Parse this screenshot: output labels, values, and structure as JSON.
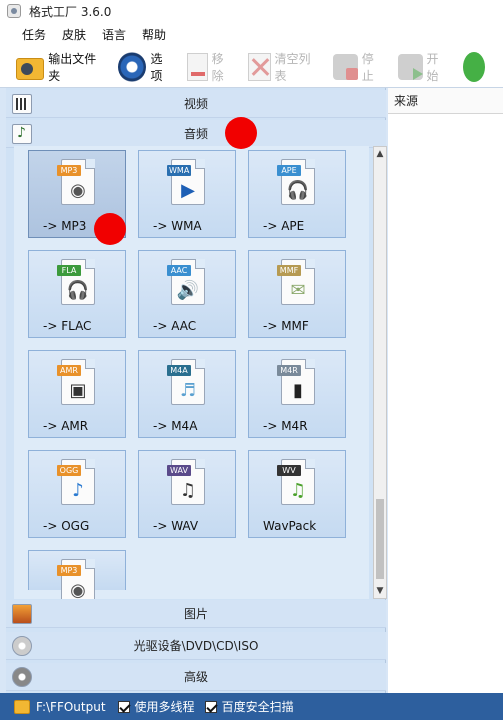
{
  "window": {
    "title": "格式工厂 3.6.0"
  },
  "menubar": {
    "items": [
      "任务",
      "皮肤",
      "语言",
      "帮助"
    ]
  },
  "toolbar": {
    "output_folder": "输出文件夹",
    "options": "选项",
    "remove": "移除",
    "clear_list": "清空列表",
    "stop": "停止",
    "start": "开始"
  },
  "categories": {
    "video": "视频",
    "audio": "音频",
    "picture": "图片",
    "dvd": "光驱设备\\DVD\\CD\\ISO",
    "advanced": "高级"
  },
  "audio_formats": [
    {
      "badge": "MP3",
      "label": "-> MP3",
      "badge_color": "#e8912a",
      "glyph": "◉",
      "glyph_color": "#555555"
    },
    {
      "badge": "WMA",
      "label": "-> WMA",
      "badge_color": "#2a6fb0",
      "glyph": "▶",
      "glyph_color": "#1d5fb5"
    },
    {
      "badge": "APE",
      "label": "-> APE",
      "badge_color": "#3a8fd0",
      "glyph": "🎧",
      "glyph_color": "#444444"
    },
    {
      "badge": "FLA",
      "label": "-> FLAC",
      "badge_color": "#3c9a3c",
      "glyph": "🎧",
      "glyph_color": "#222222"
    },
    {
      "badge": "AAC",
      "label": "-> AAC",
      "badge_color": "#3a8fd0",
      "glyph": "🔊",
      "glyph_color": "#2a7a2a"
    },
    {
      "badge": "MMF",
      "label": "-> MMF",
      "badge_color": "#b69a52",
      "glyph": "✉",
      "glyph_color": "#8aa86a"
    },
    {
      "badge": "AMR",
      "label": "-> AMR",
      "badge_color": "#e8912a",
      "glyph": "▣",
      "glyph_color": "#333333"
    },
    {
      "badge": "M4A",
      "label": "-> M4A",
      "badge_color": "#2a6f8f",
      "glyph": "♬",
      "glyph_color": "#5aa0d0"
    },
    {
      "badge": "M4R",
      "label": "-> M4R",
      "badge_color": "#7a8a9a",
      "glyph": "▮",
      "glyph_color": "#222222"
    },
    {
      "badge": "OGG",
      "label": "-> OGG",
      "badge_color": "#e8912a",
      "glyph": "♪",
      "glyph_color": "#2a7ad0"
    },
    {
      "badge": "WAV",
      "label": "-> WAV",
      "badge_color": "#5a4a8a",
      "glyph": "♫",
      "glyph_color": "#333333"
    },
    {
      "badge": "WV",
      "label": "WavPack",
      "badge_color": "#333333",
      "glyph": "♫",
      "glyph_color": "#4aa02a"
    },
    {
      "badge": "MP3",
      "label": "",
      "badge_color": "#e8912a",
      "glyph": "◉",
      "glyph_color": "#555555"
    }
  ],
  "right_panel": {
    "header": "来源"
  },
  "statusbar": {
    "output_path": "F:\\FFOutput",
    "multithread": "使用多线程",
    "safe_scan": "百度安全扫描"
  },
  "colors": {
    "marker_dot": "#f10000",
    "statusbar_bg": "#2d5f9e"
  }
}
